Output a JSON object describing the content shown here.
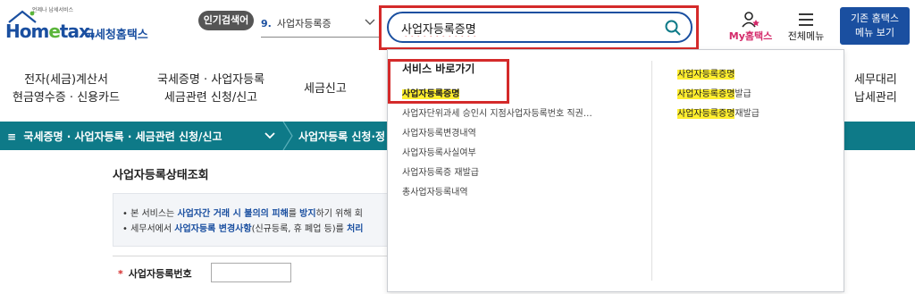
{
  "header": {
    "logo_tagline": "언제나 납세서비스",
    "logo_brand_pre": "Hom",
    "logo_brand_e": "e",
    "logo_brand_post": "tax.",
    "logo_korean": "국세청홈택스",
    "hot_search_label": "인기검색어",
    "hot_search_rank": "9.",
    "hot_search_term": "사업자등록증",
    "search_value": "사업자등록증명",
    "my_hometax_label": "My홈택스",
    "all_menu_label": "전체메뉴",
    "classic_button_line1": "기존 홈택스",
    "classic_button_line2": "메뉴 보기"
  },
  "gnb": {
    "item1_line1": "전자(세금)계산서",
    "item1_line2": "현금영수증 · 신용카드",
    "item2_line1": "국세증명 · 사업자등록",
    "item2_line2": "세금관련 신청/신고",
    "item3": "세금신고",
    "item4_line1": "세무대리",
    "item4_line2": "납세관리"
  },
  "breadcrumb": {
    "menu_icon": "≡",
    "section": "국세증명 · 사업자등록 · 세금관련 신청/신고",
    "current": "사업자등록 신청·정"
  },
  "content": {
    "page_title": "사업자등록상태조회",
    "notice_line1_a": "• 본 서비스는 ",
    "notice_line1_b": "사업자간 거래 시 불의의 피해",
    "notice_line1_c": "를 ",
    "notice_line1_d": "방지",
    "notice_line1_e": "하기 위해 회",
    "notice_line2_a": "• 세무서에서 ",
    "notice_line2_b": "사업자등록 변경사항",
    "notice_line2_c": "(신규등록, 휴 폐업 등)를 ",
    "notice_line2_d": "처리",
    "bizno_label": "사업자등록번호",
    "required_mark": "*"
  },
  "dropdown": {
    "heading": "서비스 바로가기",
    "left_items": [
      "사업자등록증명",
      "사업자단위과세 승인시 지점사업자등록번호 직권…",
      "사업자등록변경내역",
      "사업자등록사실여부",
      "사업자등록증 재발급",
      "총사업자등록내역"
    ],
    "right_items": [
      {
        "hl": "사업자등록증명",
        "rest": ""
      },
      {
        "hl": "사업자등록증명",
        "rest": "발급"
      },
      {
        "hl": "사업자등록증명",
        "rest": "재발급"
      }
    ]
  },
  "colors": {
    "brand_blue": "#1a4fa0",
    "teal_bar": "#0e7a88",
    "highlight_red": "#d42a2a",
    "match_yellow": "#ffee2e"
  },
  "icons": [
    "search-icon",
    "person-star-icon",
    "hamburger-icon",
    "chevron-down-icon",
    "menu-icon"
  ]
}
